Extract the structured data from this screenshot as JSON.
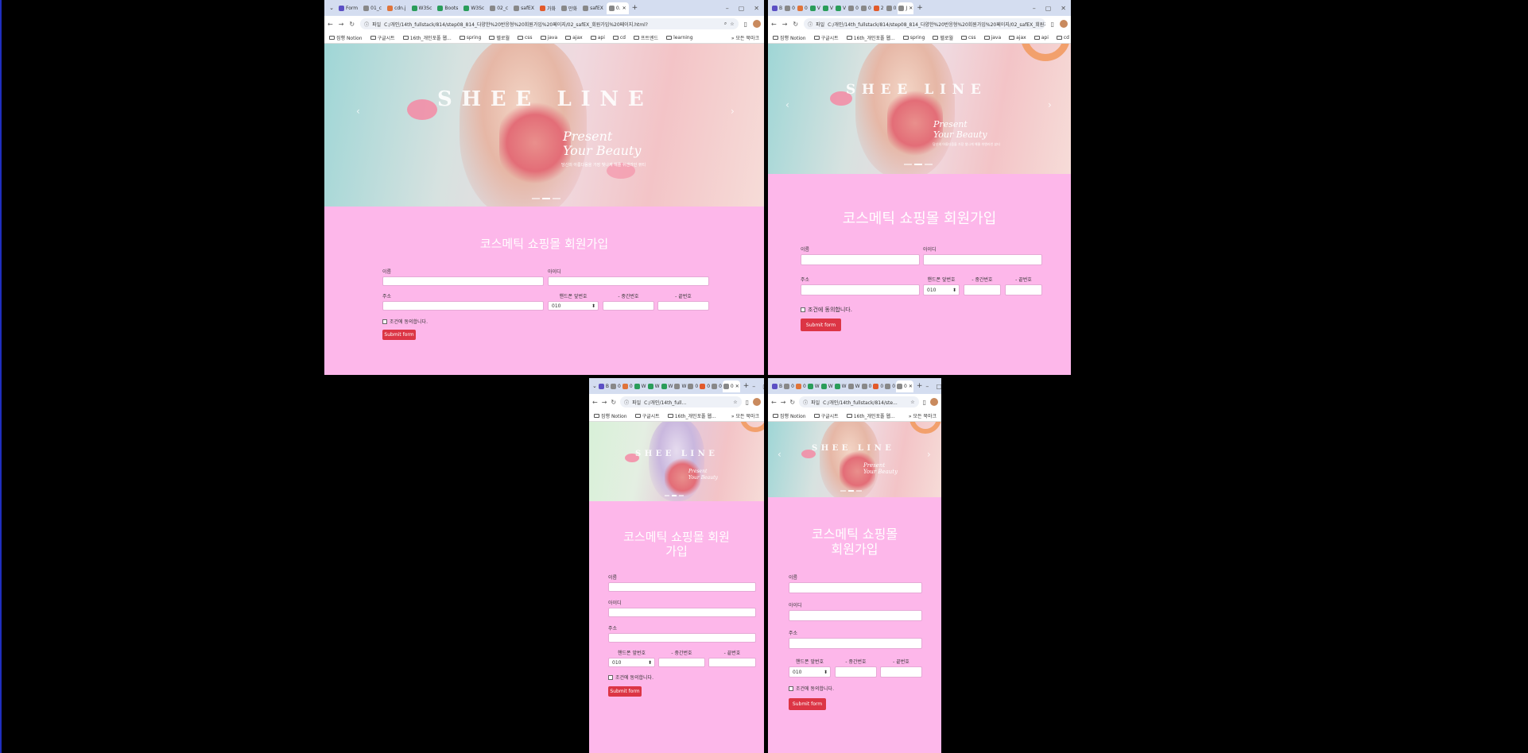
{
  "tabs_w1": [
    "Form",
    "01_c",
    "cdn.j",
    "W3Sc",
    "Boots",
    "W3Sc",
    "02_c",
    "safEX",
    "가화",
    "만화",
    "safEX",
    "0."
  ],
  "tabs_w2": [
    "B",
    "0",
    "0",
    "V",
    "V",
    "V",
    "0",
    "0",
    "2",
    "0",
    "J"
  ],
  "tabs_w3": [
    "B",
    "0",
    "0",
    "W",
    "W",
    "W",
    "W",
    "0",
    "0",
    "0",
    "0"
  ],
  "tabs_w4": [
    "B",
    "0",
    "0",
    "W",
    "W",
    "W",
    "W",
    "0",
    "0",
    "0",
    "0"
  ],
  "address": {
    "secure": "파일",
    "url_w1": "C:/개인/14th_fullstack/814/step08_814_다양한%20반응형%20회원가입%20페이지/02_safEX_회원가입%20페이지.html?",
    "url_w2": "C:/개인/14th_fullstack/814/step08_814_다양한%20반응형%20회원가입%20페이지/02_safEX_회원가입%20페이지.html",
    "url_w3": "C:/개인/14th_full...",
    "url_w4": "C:/개인/14th_fullstack/814/ste..."
  },
  "bookmarks": [
    "짐행 Notion",
    "구글시트",
    "16th_개인포폴 웹...",
    "spring",
    "헬로월",
    "css",
    "java",
    "ajax",
    "api",
    "cd",
    "프트엔드",
    "learning"
  ],
  "bookmarks_short": [
    "짐행 Notion",
    "구글시트",
    "16th_개인포폴 웹..."
  ],
  "all_bookmarks": "모든 북마크",
  "hero": {
    "brand": "SHEE LINE",
    "present": "Present",
    "beauty": "Your Beauty",
    "sub": "당신의 아름다움을 가장 빛나게 해줄 쉬앤라인 뷰티"
  },
  "form": {
    "title": "코스메틱 쇼핑몰 회원가입",
    "title_l1": "코스메틱 쇼핑몰 회원",
    "title_l2": "가입",
    "title_m1": "코스메틱 쇼핑몰",
    "title_m2": "회원가입",
    "name": "이름",
    "id": "아이디",
    "addr": "주소",
    "phone": "핸드폰 앞번호",
    "mid": "- 중간번호",
    "last": "- 끝번호",
    "phone_val": "010",
    "agree": "조건에 동의합니다.",
    "submit": "Submit form"
  },
  "colors": {
    "form_bg": "#fdb7ea",
    "button": "#dc3545",
    "tab_bar": "#d4ddf0"
  }
}
